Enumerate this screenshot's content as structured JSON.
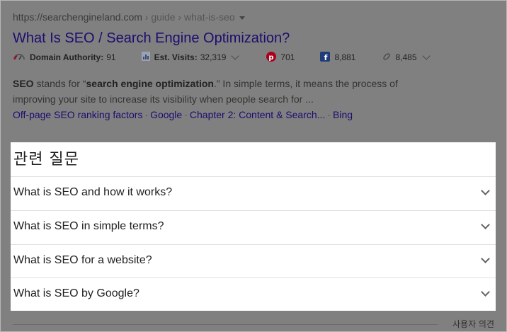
{
  "result": {
    "url_domain": "https://searchengineland.com",
    "url_path": " › guide › what-is-seo",
    "title": "What Is SEO / Search Engine Optimization?",
    "metrics": {
      "domain_authority_label": "Domain Authority:",
      "domain_authority_value": "91",
      "est_visits_label": "Est. Visits:",
      "est_visits_value": "32,319",
      "pinterest_count": "701",
      "facebook_count": "8,881",
      "links_count": "8,485"
    },
    "snippet": {
      "term": "SEO",
      "part1": " stands for “",
      "bold": "search engine optimization",
      "part2": ".” In simple terms, it means the process of improving your site to increase its visibility when people search for ..."
    },
    "sitelinks": [
      "Off-page SEO ranking factors",
      "Google",
      "Chapter 2: Content & Search...",
      "Bing"
    ]
  },
  "related_questions": {
    "heading": "관련 질문",
    "items": [
      "What is SEO and how it works?",
      "What is SEO in simple terms?",
      "What is SEO for a website?",
      "What is SEO by Google?"
    ]
  },
  "footer": {
    "feedback_label": "사용자 의견"
  },
  "colors": {
    "overlay": "#808080",
    "link": "#1a0d6f",
    "pinterest": "#a9001b",
    "facebook": "#1f3c78"
  }
}
